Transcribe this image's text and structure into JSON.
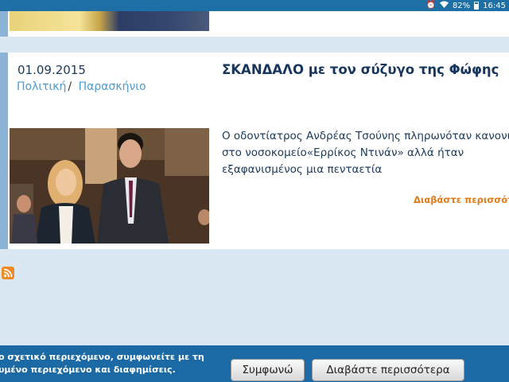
{
  "status_bar": {
    "battery_percent": "82%",
    "time": "16:45",
    "icons": [
      "alarm-icon",
      "wifi-icon",
      "battery-icon"
    ]
  },
  "article": {
    "date": "01.09.2015",
    "categories": [
      "Πολιτική",
      "Παρασκήνιο"
    ],
    "category_separator": "/",
    "title": "ΣΚΑΝΔΑΛΟ με τον σύζυγο της Φώφης",
    "excerpt_lines": [
      "Ο οδοντίατρος Ανδρέας Τσούνης πληρωνόταν κανονικά",
      "στο νοσοκομείο«Ερρίκος Ντινάν» αλλά ήταν",
      "εξαφανισμένος μια πενταετία"
    ],
    "read_more": "Διαβάστε περισσότερ"
  },
  "rss": {
    "icon": "rss-icon"
  },
  "cookie_banner": {
    "text_line1": "ο σχετικό περιεχόμενο, συμφωνείτε με τη",
    "text_line2": "υμένο περιεχόμενο και διαφημίσεις.",
    "accept_label": "Συμφωνώ",
    "read_more_label": "Διαβάστε περισσότερα"
  },
  "colors": {
    "page_background": "#d9e8f3",
    "card_accent": "#8ab3d6",
    "title": "#16365d",
    "category_link": "#4f9bd0",
    "read_more": "#e07b18",
    "banner": "#1b6aa5"
  }
}
